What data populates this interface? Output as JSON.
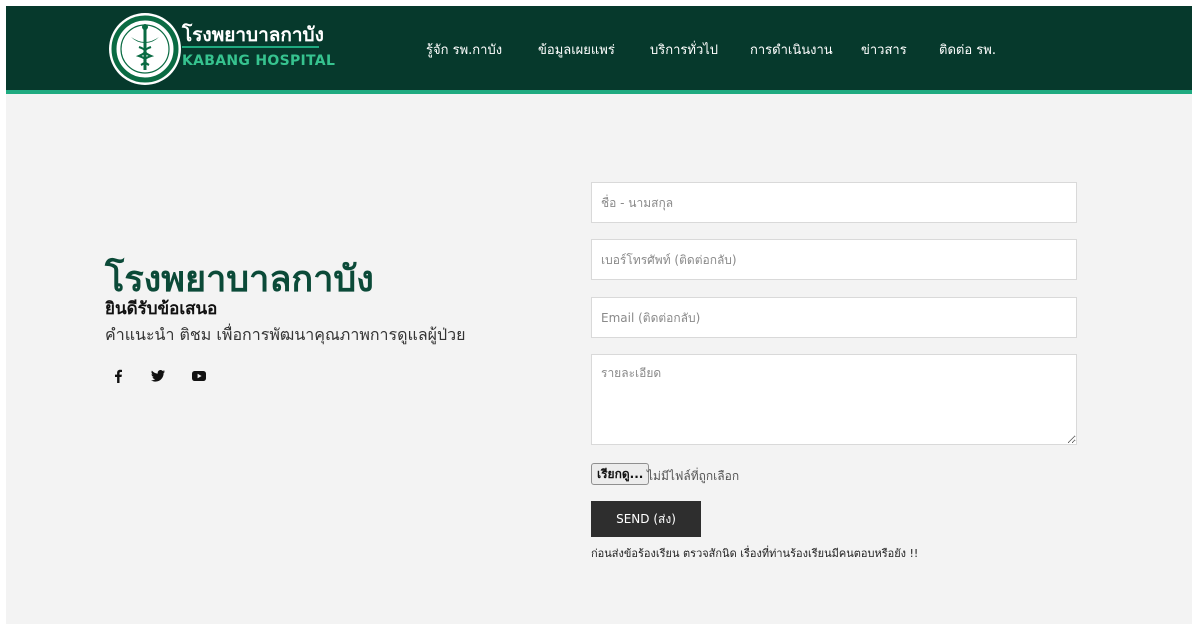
{
  "header": {
    "brand_th": "โรงพยาบาลกาบัง",
    "brand_en": "KABANG HOSPITAL",
    "logo_icon": "caduceus-emblem-icon",
    "nav": [
      {
        "label": "รู้จัก รพ.กาบัง"
      },
      {
        "label": "ข้อมูลเผยแพร่"
      },
      {
        "label": "บริการทั่วไป"
      },
      {
        "label": "การดำเนินงาน"
      },
      {
        "label": "ข่าวสาร"
      },
      {
        "label": "ติดต่อ รพ."
      }
    ]
  },
  "hero": {
    "title": "โรงพยาบาลกาบัง",
    "subtitle": "ยินดีรับข้อเสนอ",
    "description": "คำแนะนำ ติชม เพื่อการพัฒนาคุณภาพการดูแลผู้ป่วย",
    "social": [
      "facebook-icon",
      "twitter-icon",
      "youtube-icon"
    ]
  },
  "form": {
    "name_placeholder": "ชื่อ - นามสกุล",
    "phone_placeholder": "เบอร์โทรศัพท์ (ติดต่อกลับ)",
    "email_placeholder": "Email (ติดต่อกลับ)",
    "details_placeholder": "รายละเอียด",
    "file_button": "เรียกดู...",
    "file_status": "ไม่มีไฟล์ที่ถูกเลือก",
    "send_label": "SEND (ส่ง)",
    "note": "ก่อนส่งข้อร้องเรียน ตรวจสักนิด เรื่องที่ท่านร้องเรียนมีคนตอบหรือยัง !!"
  },
  "colors": {
    "header_bg": "#06392c",
    "accent": "#1faa80",
    "title_green": "#0b4a38"
  }
}
